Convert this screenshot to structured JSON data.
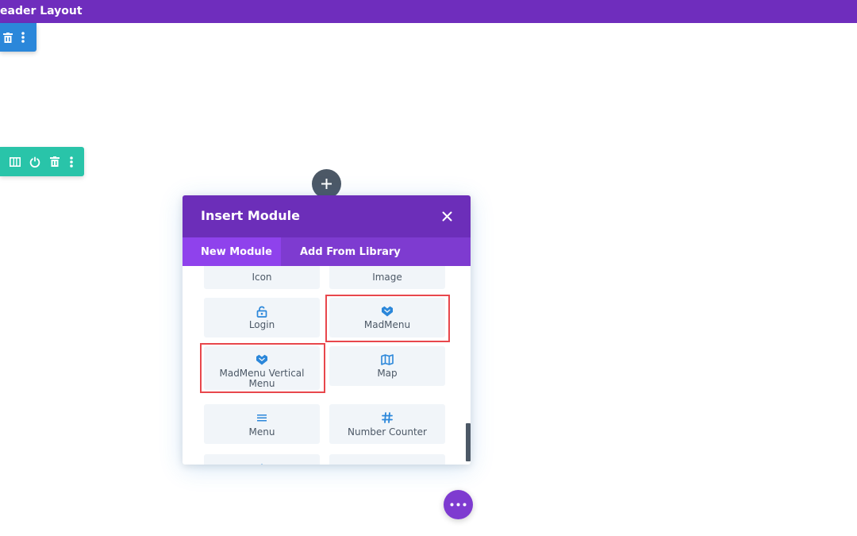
{
  "topbar": {
    "title": "eader Layout",
    "color": "#6f2dbd"
  },
  "blue_toolbar": {
    "icons": [
      "trash-icon",
      "more-vertical-icon"
    ],
    "color": "#2b87da"
  },
  "green_toolbar": {
    "icons": [
      "columns-icon",
      "power-icon",
      "trash-icon",
      "more-vertical-icon"
    ],
    "color": "#29c4a9"
  },
  "modal": {
    "title": "Insert Module",
    "tabs": [
      {
        "label": "New Module",
        "active": true
      },
      {
        "label": "Add From Library",
        "active": false
      }
    ],
    "modules": [
      {
        "label": "Icon",
        "icon": "circle-icon"
      },
      {
        "label": "Image",
        "icon": "image-icon"
      },
      {
        "label": "Login",
        "icon": "unlock-icon"
      },
      {
        "label": "MadMenu",
        "icon": "madmenu-logo-icon",
        "highlighted": true
      },
      {
        "label": "MadMenu Vertical Menu",
        "icon": "madmenu-logo-icon",
        "highlighted": true
      },
      {
        "label": "Map",
        "icon": "map-icon"
      },
      {
        "label": "Menu",
        "icon": "menu-icon"
      },
      {
        "label": "Number Counter",
        "icon": "hash-icon"
      }
    ]
  },
  "colors": {
    "accent_purple": "#6c2eb9",
    "tab_purple": "#7e3bd0",
    "icon_blue": "#2b87da",
    "highlight_red": "#e8474c"
  }
}
